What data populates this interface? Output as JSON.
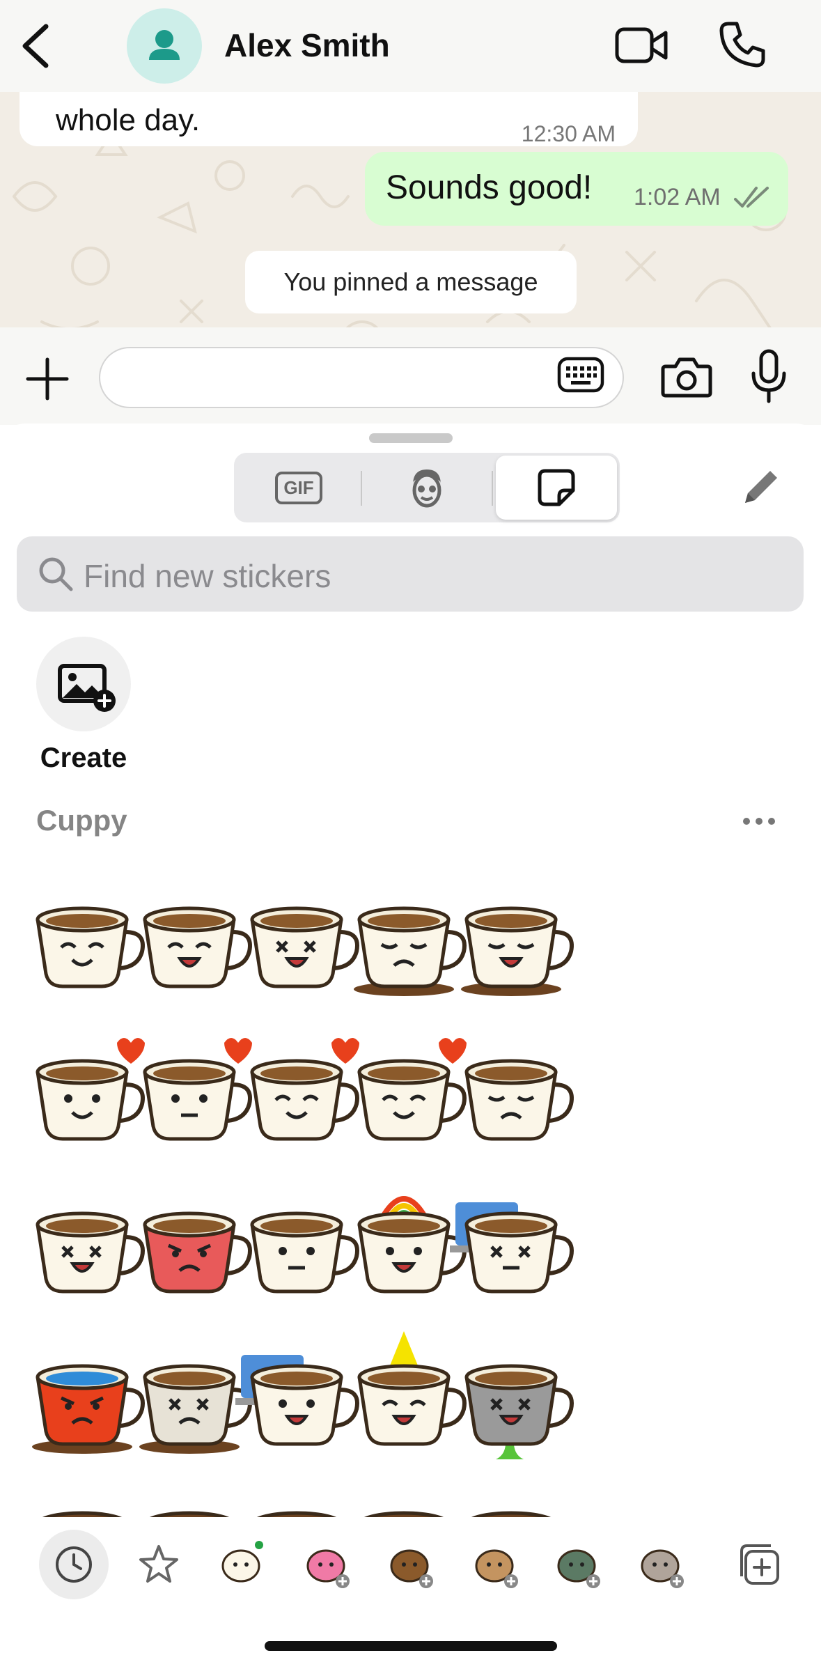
{
  "header": {
    "contact_name": "Alex Smith"
  },
  "chat": {
    "incoming": {
      "text": "whole day.",
      "time": "12:30 AM"
    },
    "outgoing": {
      "text": "Sounds good!",
      "time": "1:02 AM"
    },
    "system_message": "You pinned a message"
  },
  "composer": {
    "placeholder": ""
  },
  "sheet": {
    "tabs": {
      "gif_label": "GIF"
    },
    "search_placeholder": "Find new stickers",
    "create_label": "Create",
    "pack_title": "Cuppy"
  },
  "stickers": [
    "coffee-cup-smile-sticker",
    "coffee-cup-laugh-sticker",
    "coffee-cup-tipped-crying-sticker",
    "coffee-cup-spilled-sad-sticker",
    "coffee-cup-melted-crying-sticker",
    "latte-heart-love-sticker",
    "latte-broken-heart-sticker",
    "coffee-cups-couple-sticker",
    "latte-cookie-heart-sticker",
    "coffee-cup-steaming-frown-sticker",
    "coffee-cup-splash-dizzy-sticker",
    "red-cup-angry-sticker",
    "coffee-cup-confused-sticker",
    "coffee-cup-rainbow-sticker",
    "coffee-cup-laptop-dizzy-sticker",
    "red-mug-furious-sticker",
    "coffee-cup-low-battery-sticker",
    "coffee-cup-night-laptop-sticker",
    "coffee-cup-party-hat-sticker",
    "green-cup-sick-sticker"
  ],
  "tray": [
    "recent-icon",
    "favorites-star-icon",
    "cuppy-pack-icon",
    "pink-creature-pack-icon",
    "bear-pack-icon",
    "hamster-pack-icon",
    "dino-pack-icon",
    "cat-pack-icon",
    "add-pack-icon"
  ],
  "colors": {
    "outgoing_bubble": "#d8fdd2",
    "chat_background": "#f2ede5",
    "avatar_teal": "#1c9a8a",
    "new_pack_dot": "#25a244"
  }
}
